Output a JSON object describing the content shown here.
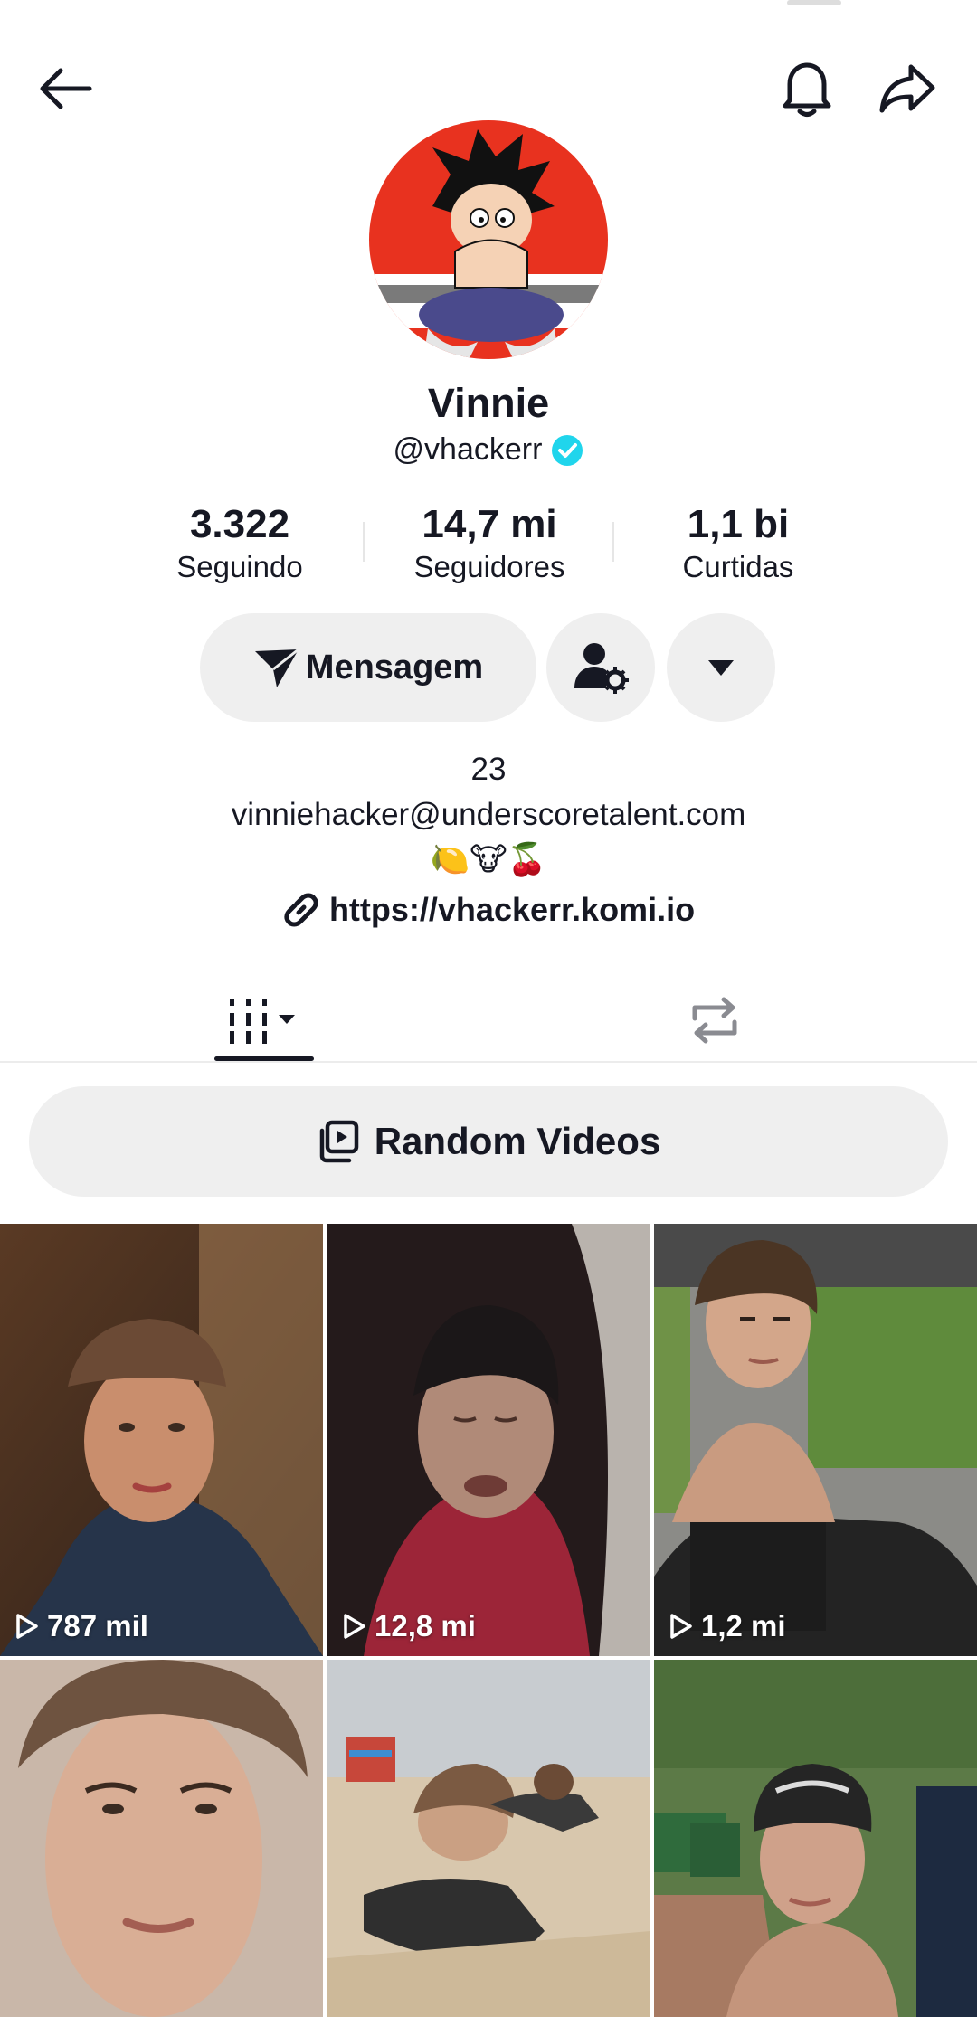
{
  "profile": {
    "display_name": "Vinnie",
    "handle": "@vhackerr"
  },
  "stats": [
    {
      "value": "3.322",
      "label": "Seguindo"
    },
    {
      "value": "14,7 mi",
      "label": "Seguidores"
    },
    {
      "value": "1,1 bi",
      "label": "Curtidas"
    }
  ],
  "actions": {
    "message_label": "Mensagem"
  },
  "bio": {
    "line1": "23",
    "line2": "vinniehacker@underscoretalent.com",
    "line3": "🍋🐮🍒",
    "link": "https://vhackerr.komi.io"
  },
  "random_videos_label": "Random Videos",
  "videos": [
    {
      "views": "787 mil"
    },
    {
      "views": "12,8 mi"
    },
    {
      "views": "1,2 mi"
    },
    {
      "views": ""
    },
    {
      "views": ""
    },
    {
      "views": ""
    }
  ],
  "colors": {
    "accent_verified": "#20D5EC",
    "button_bg": "#EFEFEF",
    "text": "#161823"
  }
}
